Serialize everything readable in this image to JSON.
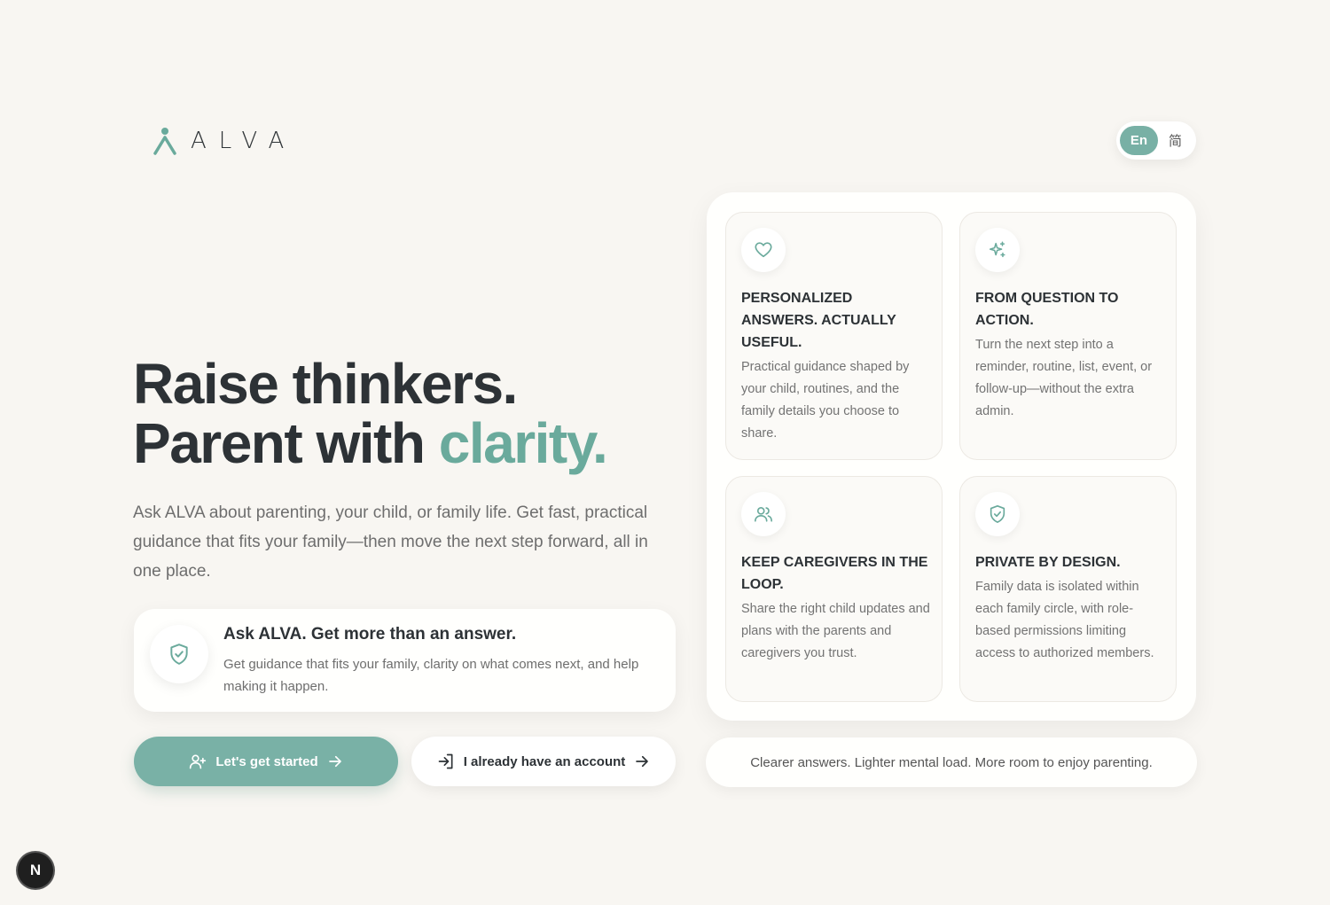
{
  "brand": {
    "name": "ALVA",
    "accent": "#78b0a5"
  },
  "lang_toggle": {
    "active": "En",
    "inactive": "简"
  },
  "hero": {
    "line1": "Raise thinkers.",
    "line2_prefix": "Parent with",
    "line2_accent": "clarity.",
    "description": "Ask ALVA about parenting, your child, or family life. Get fast, practical guidance that fits your family—then move the next step forward, all in one place."
  },
  "ask_card": {
    "icon": "shield-check-icon",
    "title": "Ask ALVA. Get more than an answer.",
    "subtitle": "Get guidance that fits your family, clarity on what comes next, and help making it happen."
  },
  "buttons": {
    "primary_label": "Let's get started",
    "secondary_label": "I already have an account"
  },
  "features": [
    {
      "icon": "heart-icon",
      "title": "PERSONALIZED ANSWERS. ACTUALLY USEFUL.",
      "body": "Practical guidance shaped by your child, routines, and the family details you choose to share."
    },
    {
      "icon": "sparkles-icon",
      "title": "FROM QUESTION TO ACTION.",
      "body": "Turn the next step into a reminder, routine, list, event, or follow-up—without the extra admin."
    },
    {
      "icon": "users-icon",
      "title": "KEEP CAREGIVERS IN THE LOOP.",
      "body": "Share the right child updates and plans with the parents and caregivers you trust."
    },
    {
      "icon": "shield-check-icon",
      "title": "PRIVATE BY DESIGN.",
      "body": "Family data is isolated within each family circle, with role-based permissions limiting access to authorized members."
    }
  ],
  "tagline": "Clearer answers. Lighter mental load. More room to enjoy parenting.",
  "dev_badge": "N"
}
